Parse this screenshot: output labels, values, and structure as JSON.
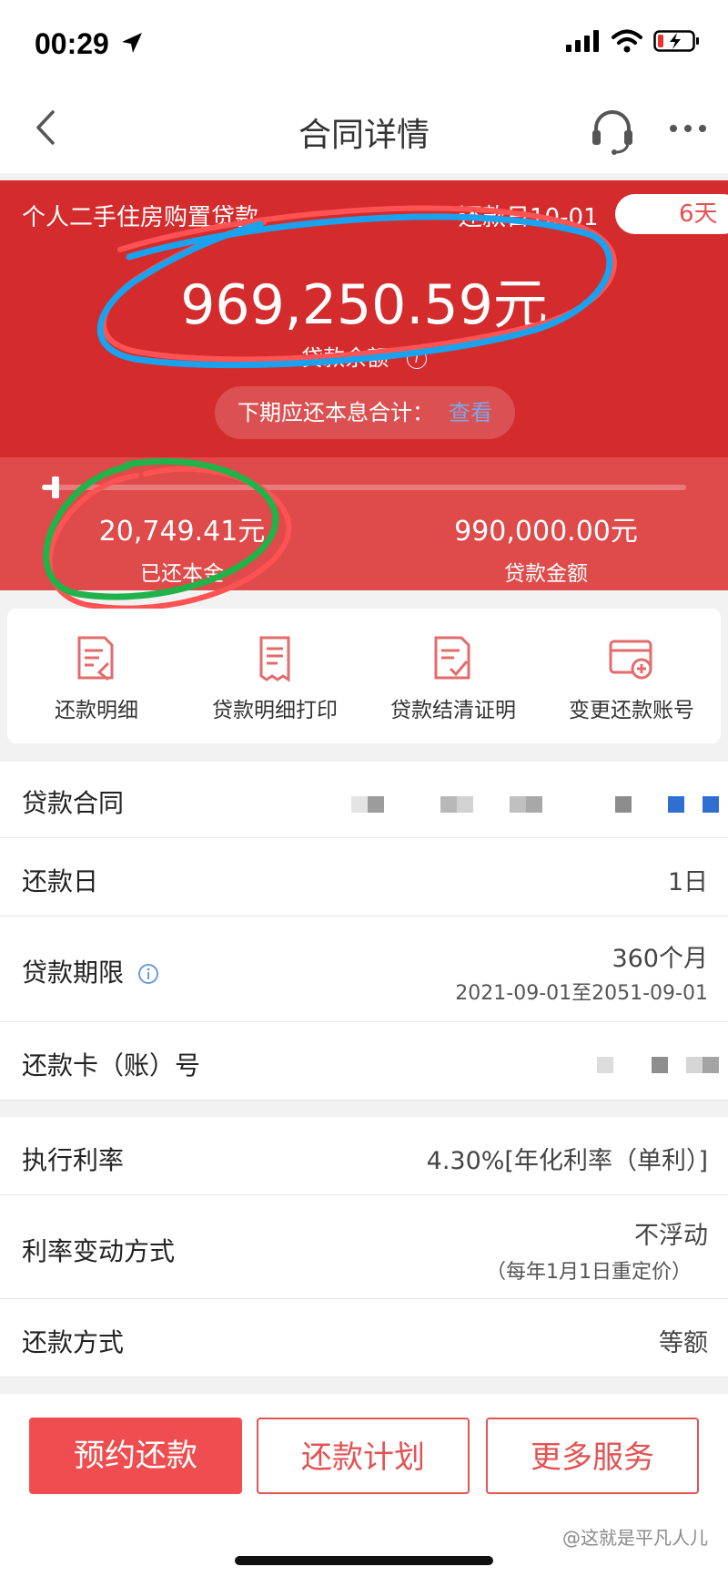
{
  "status_bar": {
    "time": "00:29"
  },
  "nav": {
    "title": "合同详情"
  },
  "loan": {
    "type": "个人二手住房购置贷款",
    "due_label": "还款日10-01",
    "days": "6天",
    "balance": "969,250.59元",
    "balance_label": "贷款余额",
    "info_glyph": "i",
    "next_label": "下期应还本息合计：",
    "next_link": "查看",
    "progress": 0.021,
    "repaid_value": "20,749.41元",
    "repaid_label": "已还本金",
    "total_value": "990,000.00元",
    "total_label": "贷款金额"
  },
  "quick_actions": [
    {
      "label": "还款明细"
    },
    {
      "label": "贷款明细打印"
    },
    {
      "label": "贷款结清证明"
    },
    {
      "label": "变更还款账号"
    }
  ],
  "details": {
    "contract": {
      "label": "贷款合同"
    },
    "repay_day": {
      "label": "还款日",
      "value": "1日"
    },
    "term": {
      "label": "贷款期限",
      "value": "360个月",
      "sub": "2021-09-01至2051-09-01"
    },
    "card": {
      "label": "还款卡（账）号"
    },
    "rate": {
      "label": "执行利率",
      "value": "4.30%[年化利率（单利）]"
    },
    "rate_change": {
      "label": "利率变动方式",
      "value": "不浮动",
      "sub": "（每年1月1日重定价）"
    },
    "method": {
      "label": "还款方式",
      "value": "等额"
    }
  },
  "actions": {
    "appointment": "预约还款",
    "plan": "还款计划",
    "more": "更多服务"
  },
  "watermark": "@这就是平凡人儿",
  "colors": {
    "brand_red": "#d42b2d",
    "button_red": "#ef4d4f",
    "link_blue": "#7fa6e6"
  }
}
